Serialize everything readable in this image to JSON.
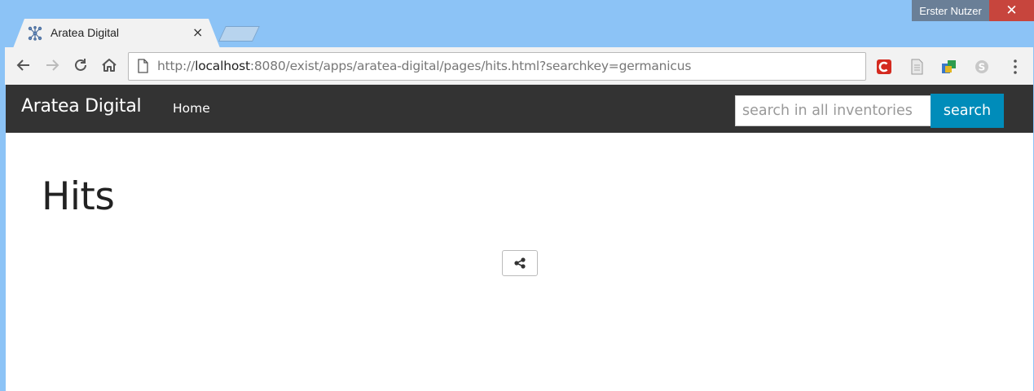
{
  "browser": {
    "tab": {
      "title": "Aratea Digital",
      "close": "×"
    },
    "user": "Erster Nutzer",
    "window_close": "✕",
    "url": {
      "scheme": "http://",
      "host": "localhost",
      "rest": ":8080/exist/apps/aratea-digital/pages/hits.html?searchkey=germanicus"
    },
    "icons": {
      "back": "back-arrow-icon",
      "forward": "forward-arrow-icon",
      "reload": "reload-icon",
      "home": "home-icon",
      "page": "page-icon",
      "menu": "kebab-menu-icon"
    },
    "extensions": [
      "c-extension-icon",
      "document-extension-icon",
      "puzzle-extension-icon",
      "skype-extension-icon"
    ]
  },
  "site": {
    "brand": "Aratea Digital",
    "nav": {
      "home": "Home"
    },
    "search": {
      "placeholder": "search in all inventories",
      "button": "search"
    },
    "heading": "Hits",
    "share_icon": "share-icon"
  },
  "colors": {
    "navbar": "#333333",
    "search_button": "#008cba",
    "chrome_frame": "#8cc3f6",
    "close_red": "#c7453d"
  }
}
